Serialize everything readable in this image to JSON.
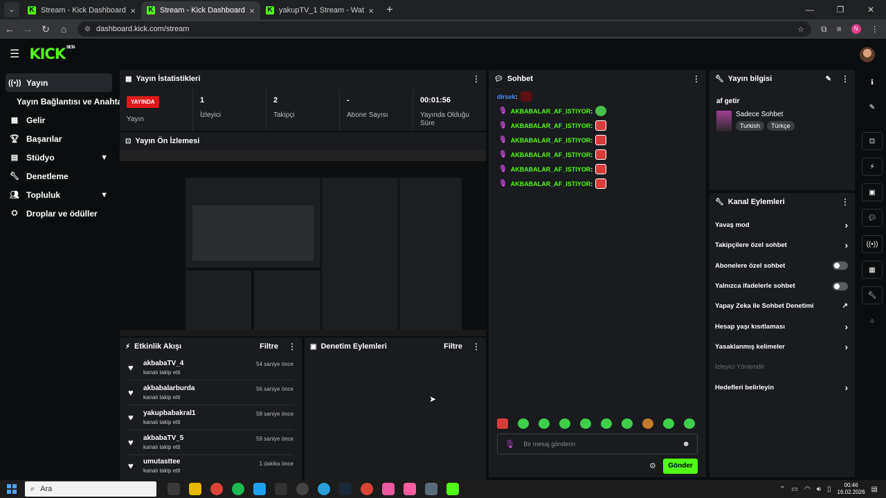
{
  "browser": {
    "tabs": [
      {
        "title": "Stream - Kick Dashboard",
        "active": false
      },
      {
        "title": "Stream - Kick Dashboard",
        "active": true
      },
      {
        "title": "yakupTV_1 Stream - Watch Live",
        "active": false
      }
    ],
    "url": "dashboard.kick.com/stream",
    "profile_initial": "N"
  },
  "header": {
    "logo": "KICK",
    "beta": "BETA"
  },
  "sidebar": {
    "items": [
      {
        "label": "Yayın",
        "icon": "broadcast-icon"
      },
      {
        "label": "Yayın Bağlantısı ve Anahtarı",
        "icon": ""
      },
      {
        "label": "Gelir",
        "icon": "chart-icon"
      },
      {
        "label": "Başarılar",
        "icon": "trophy-icon"
      },
      {
        "label": "Stüdyo",
        "icon": "grid-icon"
      },
      {
        "label": "Denetleme",
        "icon": "wrench-icon"
      },
      {
        "label": "Topluluk",
        "icon": "people-icon"
      },
      {
        "label": "Droplar ve ödüller",
        "icon": "gift-icon"
      }
    ]
  },
  "stats": {
    "title": "Yayın İstatistikleri",
    "live_badge": "YAYINDA",
    "items": [
      {
        "value": "",
        "label": "Yayın"
      },
      {
        "value": "1",
        "label": "İzleyici"
      },
      {
        "value": "2",
        "label": "Takipçi"
      },
      {
        "value": "-",
        "label": "Abone Sayısı"
      },
      {
        "value": "00:01:56",
        "label": "Yayında Olduğu Süre"
      }
    ]
  },
  "preview": {
    "title": "Yayın Ön İzlemesi"
  },
  "activity": {
    "title": "Etkinlik Akışı",
    "filter": "Filtre",
    "items": [
      {
        "name": "akbabaTV_4",
        "action": "kanalı takip etti",
        "time": "54 saniye önce"
      },
      {
        "name": "akbabalarburda",
        "action": "kanalı takip etti",
        "time": "56 saniye önce"
      },
      {
        "name": "yakupbabakral1",
        "action": "kanalı takip etti",
        "time": "58 saniye önce"
      },
      {
        "name": "akbabaTV_5",
        "action": "kanalı takip etti",
        "time": "59 saniye önce"
      },
      {
        "name": "umutasttee",
        "action": "kanalı takip etti",
        "time": "1 dakika önce"
      }
    ]
  },
  "moderation": {
    "title": "Denetim Eylemleri",
    "filter": "Filtre"
  },
  "chat": {
    "title": "Sohbet",
    "first": {
      "user": "dirsek"
    },
    "messages": [
      {
        "user": "AKBABALAR_AF_ISTIYOR"
      },
      {
        "user": "AKBABALAR_AF_ISTIYOR"
      },
      {
        "user": "AKBABALAR_AF_ISTIYOR"
      },
      {
        "user": "AKBABALAR_AF_ISTIYOR"
      },
      {
        "user": "AKBABALAR_AF_ISTIYOR"
      },
      {
        "user": "AKBABALAR_AF_ISTIYOR"
      }
    ],
    "placeholder": "Bir mesaj gönderin",
    "send": "Gönder"
  },
  "stream_info": {
    "title": "Yayın bilgisi",
    "stream_title": "af getir",
    "category": "Sadece Sohbet",
    "tags": [
      "Turkish",
      "Türkçe"
    ]
  },
  "channel_actions": {
    "title": "Kanal Eylemleri",
    "items": [
      {
        "label": "Yavaş mod",
        "control": "chevron"
      },
      {
        "label": "Takipçilere özel sohbet",
        "control": "chevron"
      },
      {
        "label": "Abonelere özel sohbet",
        "control": "toggle"
      },
      {
        "label": "Yalnızca ifadelerle sohbet",
        "control": "toggle"
      },
      {
        "label": "Yapay Zeka ile Sohbet Denetimi",
        "control": "external"
      },
      {
        "label": "Hesap yaşı kısıtlaması",
        "control": "chevron"
      },
      {
        "label": "Yasaklanmış kelimeler",
        "control": "chevron"
      },
      {
        "label": "İzleyici Yönlendir",
        "control": "none"
      },
      {
        "label": "Hedefleri belirleyin",
        "control": "chevron"
      }
    ]
  },
  "taskbar": {
    "search": "Ara",
    "time": "00:46",
    "date": "16.02.2026"
  },
  "colors": {
    "brand": "#53fc18",
    "live": "#e2171a",
    "panel": "#191b1f",
    "bg": "#0b0e0f"
  }
}
